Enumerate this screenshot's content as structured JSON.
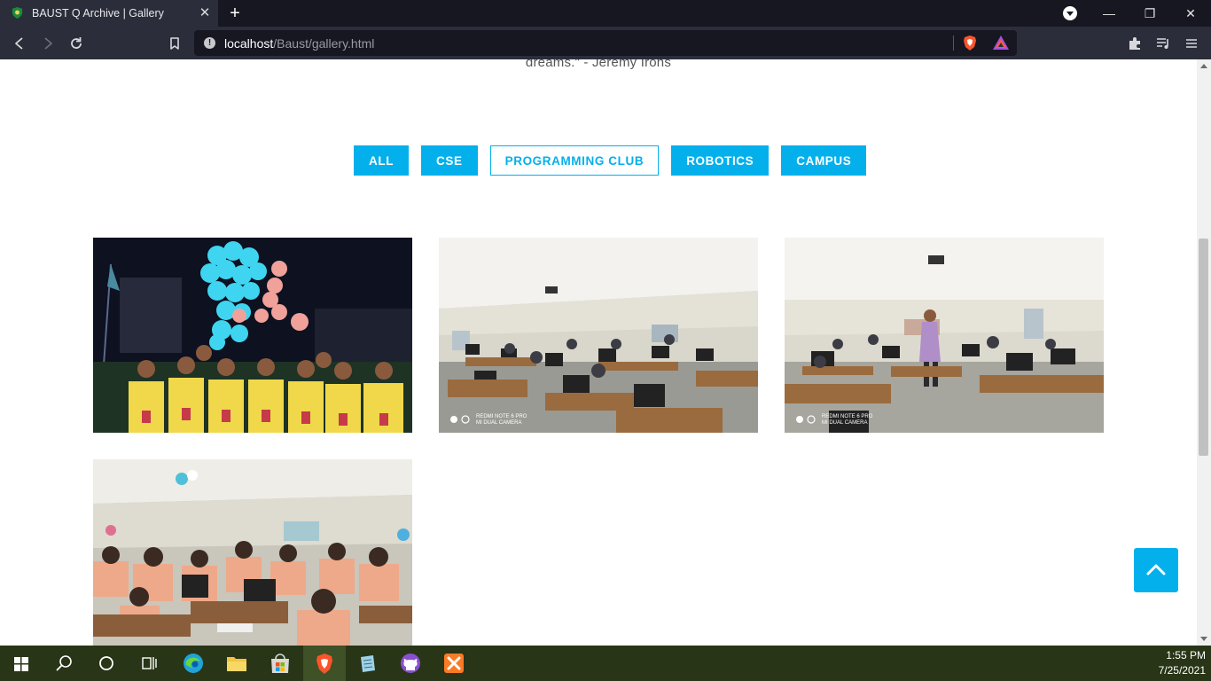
{
  "browser": {
    "tab_title": "BAUST Q Archive | Gallery",
    "url_host": "localhost",
    "url_path": "/Baust/gallery.html"
  },
  "page": {
    "quote_text": "dreams.\" - Jeremy Irons",
    "filters": [
      {
        "label": "ALL",
        "active": false
      },
      {
        "label": "CSE",
        "active": false
      },
      {
        "label": "PROGRAMMING CLUB",
        "active": true
      },
      {
        "label": "ROBOTICS",
        "active": false
      },
      {
        "label": "CAMPUS",
        "active": false
      }
    ],
    "photos": [
      {
        "watermark": ""
      },
      {
        "watermark_line1": "REDMI NOTE 6 PRO",
        "watermark_line2": "MI DUAL CAMERA"
      },
      {
        "watermark_line1": "REDMI NOTE 6 PRO",
        "watermark_line2": "MI DUAL CAMERA"
      },
      {
        "watermark": ""
      }
    ]
  },
  "taskbar": {
    "time": "1:55 PM",
    "date": "7/25/2021"
  },
  "colors": {
    "accent": "#03b0ec",
    "taskbar": "#283516",
    "chrome": "#2b2d3a"
  }
}
